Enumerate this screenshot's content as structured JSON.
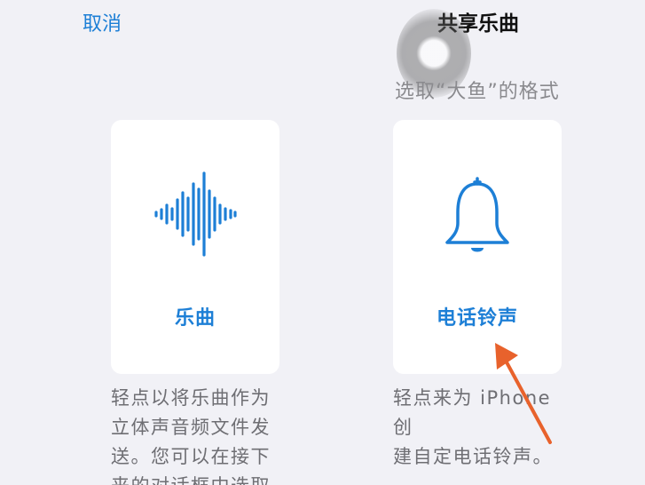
{
  "header": {
    "cancel_label": "取消",
    "title": "共享乐曲",
    "subtitle": "选取“大鱼”的格式"
  },
  "options": [
    {
      "label": "乐曲",
      "icon": "waveform-icon",
      "description_lines": [
        "轻点以将乐曲作为",
        "立体声音频文件发",
        "送。您可以在接下",
        "来的对话框中选取"
      ]
    },
    {
      "label": "电话铃声",
      "icon": "bell-icon",
      "description_lines": [
        "轻点来为 iPhone 创",
        "建自定电话铃声。"
      ]
    }
  ],
  "colors": {
    "accent": "#1d7fd6",
    "background": "#f1f1f6",
    "card": "#ffffff",
    "annotation_arrow": "#e8622c"
  }
}
